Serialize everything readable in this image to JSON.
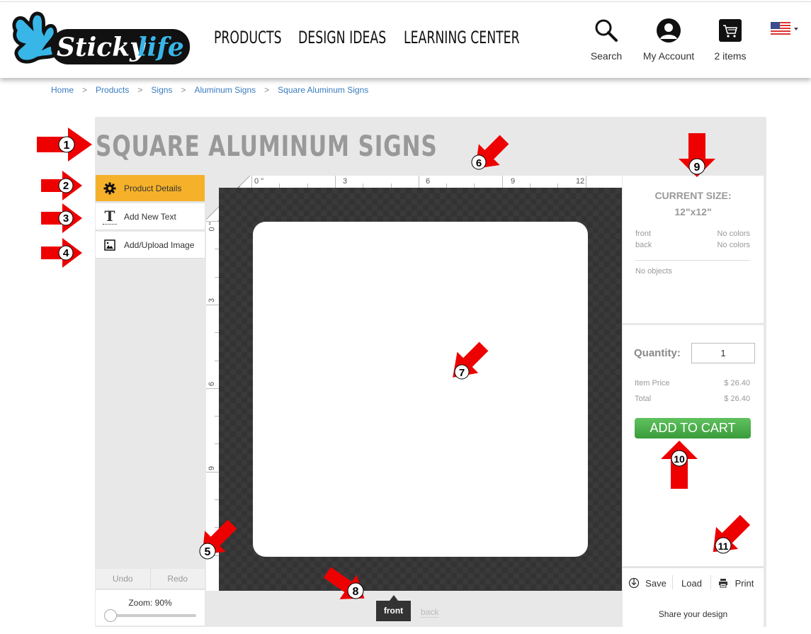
{
  "header": {
    "logo_text": "Stickylife",
    "nav": [
      "PRODUCTS",
      "DESIGN IDEAS",
      "LEARNING CENTER"
    ],
    "tools": {
      "search": "Search",
      "account": "My Account",
      "cart": "2 items"
    },
    "locale": "US"
  },
  "breadcrumb": [
    "Home",
    "Products",
    "Signs",
    "Aluminum Signs",
    "Square Aluminum Signs"
  ],
  "page_title": "SQUARE ALUMINUM SIGNS",
  "sidebar": {
    "items": [
      {
        "label": "Product Details",
        "icon": "gear-icon",
        "active": true
      },
      {
        "label": "Add New Text",
        "icon": "text-icon",
        "active": false
      },
      {
        "label": "Add/Upload Image",
        "icon": "image-icon",
        "active": false
      }
    ],
    "undo": "Undo",
    "redo": "Redo",
    "zoom_label": "Zoom: 90%",
    "zoom_percent": 90
  },
  "ruler": {
    "unit": "INCHES",
    "top_labels": [
      "0 \"",
      "3",
      "6",
      "9",
      "12"
    ],
    "left_labels": [
      "0 \"",
      "3",
      "6",
      "9"
    ]
  },
  "canvas": {
    "sides": [
      "front",
      "back"
    ],
    "active_side": "front"
  },
  "info": {
    "current_size_title": "CURRENT SIZE:",
    "current_size": "12\"x12\"",
    "rows": [
      {
        "side": "front",
        "colors": "No colors"
      },
      {
        "side": "back",
        "colors": "No colors"
      }
    ],
    "objects": "No objects"
  },
  "cart": {
    "quantity_label": "Quantity:",
    "quantity": "1",
    "item_price_label": "Item Price",
    "item_price": "$ 26.40",
    "total_label": "Total",
    "total": "$ 26.40",
    "add_to_cart": "ADD TO CART"
  },
  "actions": {
    "save": "Save",
    "load": "Load",
    "print": "Print",
    "share": "Share your design"
  },
  "annotations": [
    "1",
    "2",
    "3",
    "4",
    "5",
    "6",
    "7",
    "8",
    "9",
    "10",
    "11"
  ],
  "colors": {
    "accent_orange": "#f6b12a",
    "cart_green": "#4caf50",
    "annotation_red": "#ee0000",
    "link_blue": "#3a7bbf"
  }
}
